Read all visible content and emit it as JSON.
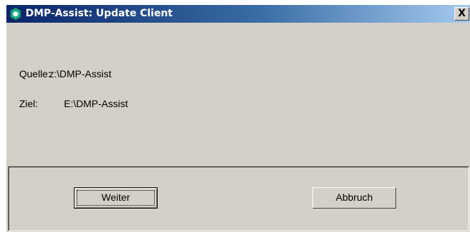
{
  "window": {
    "title": "DMP-Assist: Update Client",
    "close_label": "X"
  },
  "info": {
    "source_label": "Quelle:",
    "source_value": "z:\\DMP-Assist",
    "target_label": "Ziel:",
    "target_value": "E:\\DMP-Assist"
  },
  "buttons": {
    "next_label": "Weiter",
    "cancel_label": "Abbruch"
  },
  "colors": {
    "titlebar_start": "#0a246a",
    "titlebar_end": "#a6caf0",
    "dialog_face": "#d4d0c8",
    "app_icon": "#1fa98a"
  },
  "icons": {
    "app": "dmp-assist-app-icon",
    "close": "close-icon"
  }
}
